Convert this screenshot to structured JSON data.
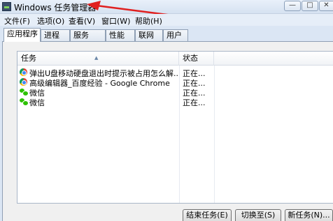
{
  "window": {
    "title": "Windows 任务管理器",
    "min_glyph": "—",
    "max_glyph": "□",
    "close_glyph": "✕"
  },
  "menu": [
    "文件(F)",
    "选项(O)",
    "查看(V)",
    "窗口(W)",
    "帮助(H)"
  ],
  "tabs": [
    "应用程序",
    "进程",
    "服务",
    "性能",
    "联网",
    "用户"
  ],
  "active_tab": "应用程序",
  "table": {
    "columns": [
      "任务",
      "状态"
    ],
    "rows": [
      {
        "icon": "chrome-icon",
        "name": "弹出U盘移动硬盘退出时提示被占用怎么解...",
        "status": "正在..."
      },
      {
        "icon": "chrome-icon",
        "name": "高级编辑器_百度经验 - Google Chrome",
        "status": "正在..."
      },
      {
        "icon": "wechat-icon",
        "name": "微信",
        "status": "正在..."
      },
      {
        "icon": "wechat-icon",
        "name": "微信",
        "status": "正在..."
      }
    ]
  },
  "buttons": {
    "end_task": "结束任务(E)",
    "switch_to": "切换至(S)",
    "new_task": "新任务(N)..."
  },
  "colors": {
    "annotation_arrow": "#e02020",
    "chrome_blue": "#4285f4",
    "wechat_green": "#2dc100"
  }
}
